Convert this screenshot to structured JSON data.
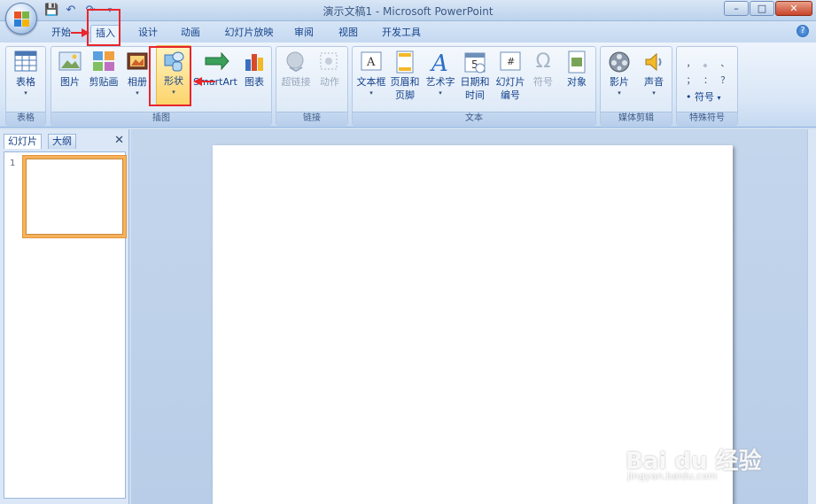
{
  "window": {
    "title": "演示文稿1 - Microsoft PowerPoint",
    "help_icon": "help-icon",
    "controls": {
      "minimize": "–",
      "maximize": "□",
      "close": "✕"
    }
  },
  "quick_access": {
    "save": "💾",
    "undo": "↶",
    "redo": "↷",
    "more": "▾"
  },
  "tabs": [
    "开始",
    "插入",
    "设计",
    "动画",
    "幻灯片放映",
    "审阅",
    "视图",
    "开发工具"
  ],
  "active_tab": "插入",
  "ribbon": {
    "groups": [
      {
        "label": "表格",
        "buttons": [
          {
            "label": "表格",
            "arrow": "▾"
          }
        ]
      },
      {
        "label": "插图",
        "buttons": [
          {
            "label": "图片"
          },
          {
            "label": "剪贴画"
          },
          {
            "label": "相册",
            "arrow": "▾"
          },
          {
            "label": "形状",
            "arrow": "▾"
          },
          {
            "label": "SmartArt"
          },
          {
            "label": "图表"
          }
        ]
      },
      {
        "label": "链接",
        "buttons": [
          {
            "label": "超链接"
          },
          {
            "label": "动作"
          }
        ]
      },
      {
        "label": "文本",
        "buttons": [
          {
            "label": "文本框",
            "arrow": "▾"
          },
          {
            "label": "页眉和",
            "label2": "页脚"
          },
          {
            "label": "艺术字",
            "arrow": "▾"
          },
          {
            "label": "日期和",
            "label2": "时间"
          },
          {
            "label": "幻灯片",
            "label2": "编号"
          },
          {
            "label": "符号"
          },
          {
            "label": "对象"
          }
        ]
      },
      {
        "label": "媒体剪辑",
        "buttons": [
          {
            "label": "影片",
            "arrow": "▾"
          },
          {
            "label": "声音",
            "arrow": "▾"
          }
        ]
      },
      {
        "label": "特殊符号",
        "symbols": [
          "，",
          "。",
          "、",
          "；",
          "：",
          "？"
        ],
        "buttons": [
          {
            "label": "符号",
            "arrow": "▾"
          }
        ]
      }
    ]
  },
  "left_pane": {
    "tabs": [
      "幻灯片",
      "大纲"
    ],
    "close": "✕",
    "slide_number": "1"
  },
  "watermark": {
    "line1": "Bai du 经验",
    "line2": "jingyan.baidu.com"
  },
  "colors": {
    "annotation_red": "#e8262c",
    "selected_orange": "#f7b15b"
  }
}
